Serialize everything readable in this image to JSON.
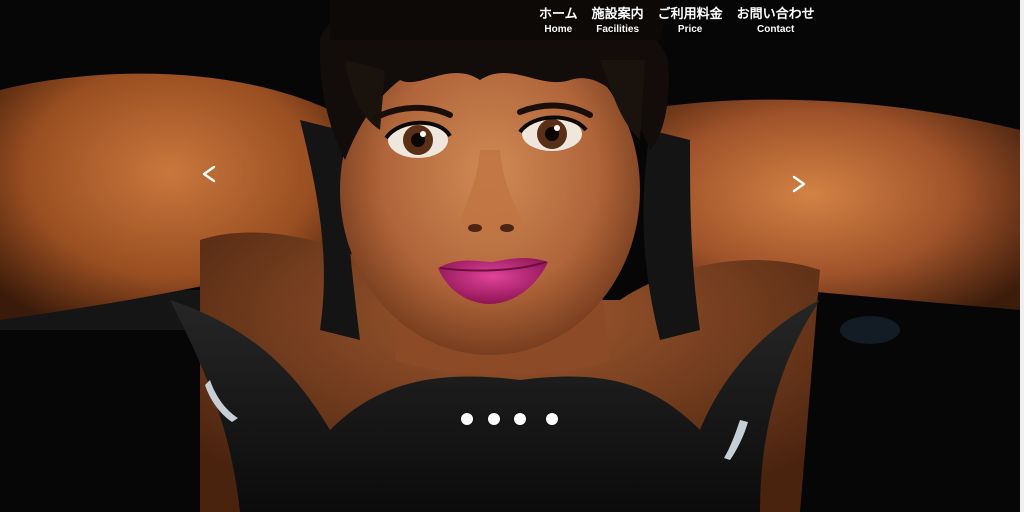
{
  "nav": {
    "items": [
      {
        "jp": "ホーム",
        "en": "Home"
      },
      {
        "jp": "施設案内",
        "en": "Facilities"
      },
      {
        "jp": "ご利用料金",
        "en": "Price"
      },
      {
        "jp": "お問い合わせ",
        "en": "Contact"
      }
    ]
  },
  "carousel": {
    "prev_glyph": "<",
    "next_glyph": ">",
    "slide_count": 4,
    "active_slide": 1
  },
  "colors": {
    "nav_text": "#ffffff",
    "background": "#050505",
    "skin": "#b5652d",
    "lips": "#c0267a",
    "tank_top": "#151515"
  }
}
